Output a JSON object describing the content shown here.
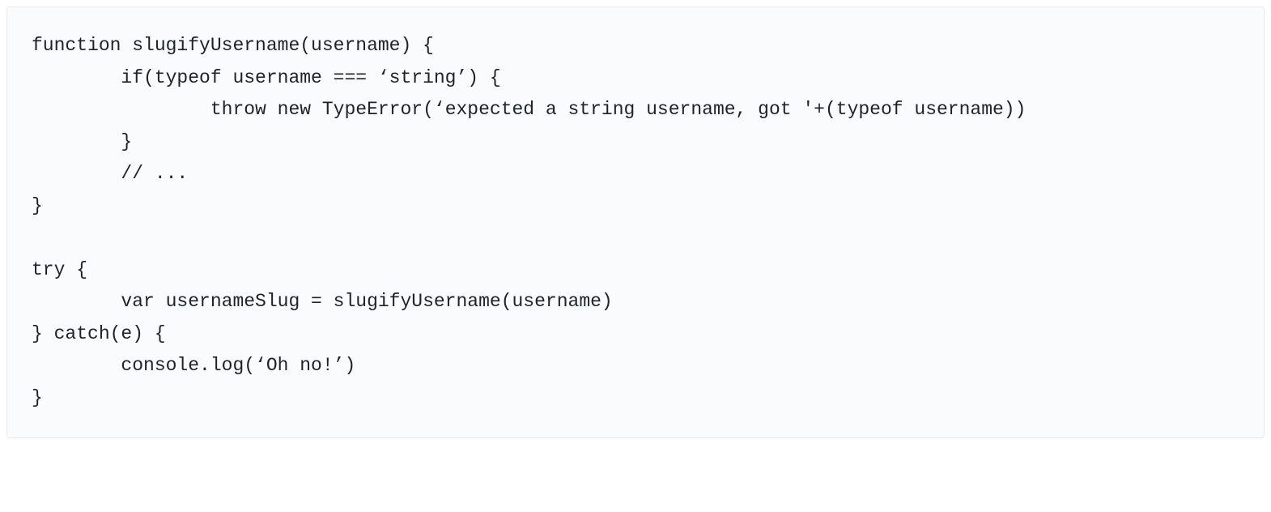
{
  "code": {
    "line1": "function slugifyUsername(username) {",
    "line2": "        if(typeof username === ‘string’) {",
    "line3": "                throw new TypeError(‘expected a string username, got '+(typeof username))",
    "line4": "        }",
    "line5": "        // ...",
    "line6": "}",
    "line7": "",
    "line8": "try {",
    "line9": "        var usernameSlug = slugifyUsername(username)",
    "line10": "} catch(e) {",
    "line11": "        console.log(‘Oh no!’)",
    "line12": "}"
  }
}
